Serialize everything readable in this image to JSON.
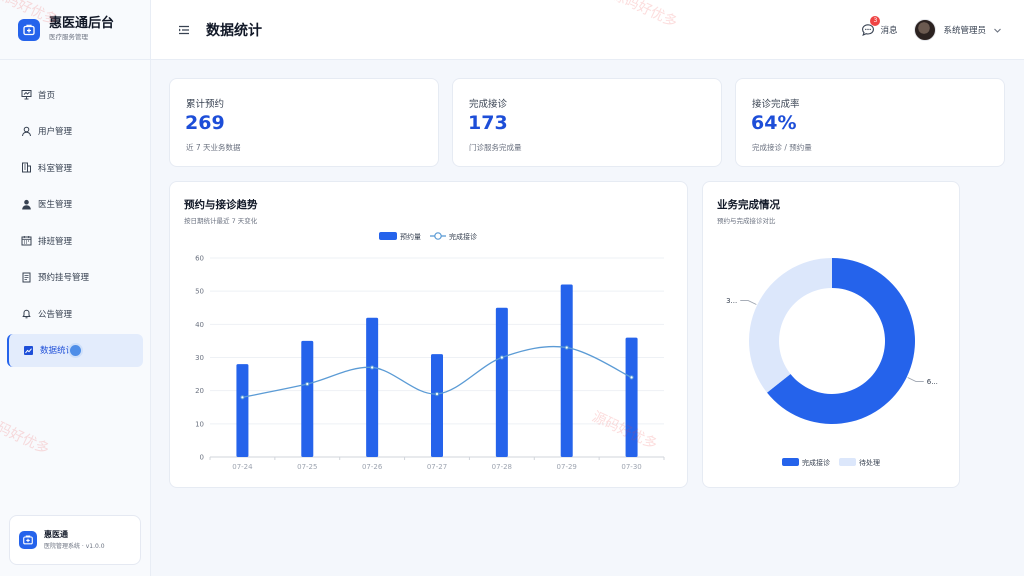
{
  "brand": {
    "title": "惠医通后台",
    "subtitle": "医疗服务管理"
  },
  "nav": {
    "items": [
      {
        "label": "首页",
        "icon": "presentation-icon"
      },
      {
        "label": "用户管理",
        "icon": "user-icon"
      },
      {
        "label": "科室管理",
        "icon": "building-icon"
      },
      {
        "label": "医生管理",
        "icon": "doctor-icon"
      },
      {
        "label": "排班管理",
        "icon": "calendar-icon"
      },
      {
        "label": "预约挂号管理",
        "icon": "document-icon"
      },
      {
        "label": "公告管理",
        "icon": "bell-icon"
      },
      {
        "label": "数据统计",
        "icon": "chart-icon",
        "active": true
      }
    ]
  },
  "side_card": {
    "title": "惠医通",
    "subtitle": "医院管理系统 · v1.0.0"
  },
  "header": {
    "title": "数据统计",
    "messages_label": "消息",
    "messages_count": "3",
    "user_name": "系统管理员"
  },
  "stats": [
    {
      "label": "累计预约",
      "value": "269",
      "desc": "近 7 天业务数据"
    },
    {
      "label": "完成接诊",
      "value": "173",
      "desc": "门诊服务完成量"
    },
    {
      "label": "接诊完成率",
      "value": "64%",
      "desc": "完成接诊 / 预约量"
    }
  ],
  "trend": {
    "title": "预约与接诊趋势",
    "subtitle": "按日期统计最近 7 天变化"
  },
  "completion": {
    "title": "业务完成情况",
    "subtitle": "预约与完成接诊对比"
  },
  "watermark": "源码好优多",
  "colors": {
    "primary": "#2563eb",
    "line": "#5b9bd5",
    "pending": "#dce7fb"
  },
  "chart_data": [
    {
      "type": "bar",
      "categories": [
        "07-24",
        "07-25",
        "07-26",
        "07-27",
        "07-28",
        "07-29",
        "07-30"
      ],
      "series": [
        {
          "name": "预约量",
          "type": "bar",
          "values": [
            28,
            35,
            42,
            31,
            45,
            52,
            36
          ]
        },
        {
          "name": "完成接诊",
          "type": "line",
          "values": [
            18,
            22,
            27,
            19,
            30,
            33,
            24
          ]
        }
      ],
      "yticks": [
        0,
        10,
        20,
        30,
        40,
        50,
        60
      ],
      "ylim": [
        0,
        60
      ],
      "grid": true,
      "legend": "top-center"
    },
    {
      "type": "pie",
      "labels": [
        "完成接诊",
        "待处理"
      ],
      "values": [
        173,
        96
      ],
      "slice_labels": [
        "6...",
        "3..."
      ],
      "donut": true,
      "legend": "bottom-center"
    }
  ]
}
